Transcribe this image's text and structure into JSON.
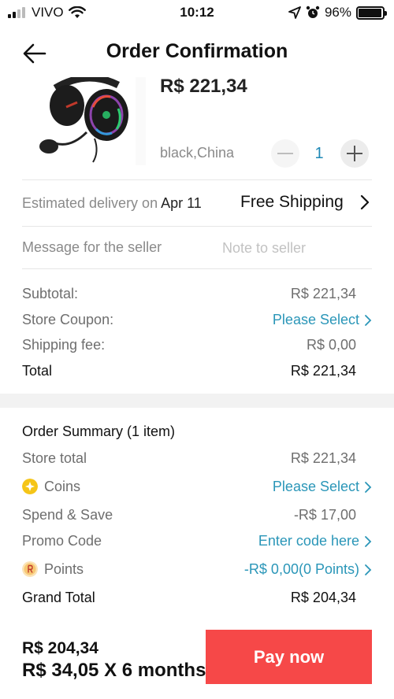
{
  "status": {
    "carrier": "VIVO",
    "time": "10:12",
    "battery": "96%",
    "battery_level": 0.96
  },
  "header": {
    "title": "Order Confirmation",
    "back_icon": "arrow-left-icon"
  },
  "product": {
    "price": "R$ 221,34",
    "variant": "black,China",
    "quantity": "1"
  },
  "delivery": {
    "label": "Estimated delivery on ",
    "date": "Apr 11",
    "shipping": "Free Shipping"
  },
  "message": {
    "label": "Message for the seller",
    "placeholder": "Note to seller",
    "value": ""
  },
  "totals": {
    "subtotal_label": "Subtotal:",
    "subtotal_value": "R$ 221,34",
    "coupon_label": "Store Coupon:",
    "coupon_link": "Please Select",
    "shipping_label": "Shipping fee:",
    "shipping_value": "R$ 0,00",
    "total_label": "Total",
    "total_value": "R$ 221,34"
  },
  "order_summary": {
    "title": "Order Summary (1 item)",
    "store_total_label": "Store total",
    "store_total_value": "R$ 221,34",
    "coins_label": "Coins",
    "coins_link": "Please Select",
    "spend_save_label": "Spend & Save",
    "spend_save_value": "-R$ 17,00",
    "promo_label": "Promo Code",
    "promo_link": "Enter code here",
    "points_label": "Points",
    "points_link": "-R$ 0,00(0 Points)",
    "grand_total_label": "Grand Total",
    "grand_total_value": "R$ 204,34"
  },
  "bottom": {
    "price": "R$ 204,34",
    "installment": "R$ 34,05 X 6 months",
    "pay_label": "Pay now"
  },
  "colors": {
    "accent_link": "#2a96b8",
    "pay_button": "#f64848",
    "coin": "#f5c518",
    "points": "#f2b33d"
  }
}
